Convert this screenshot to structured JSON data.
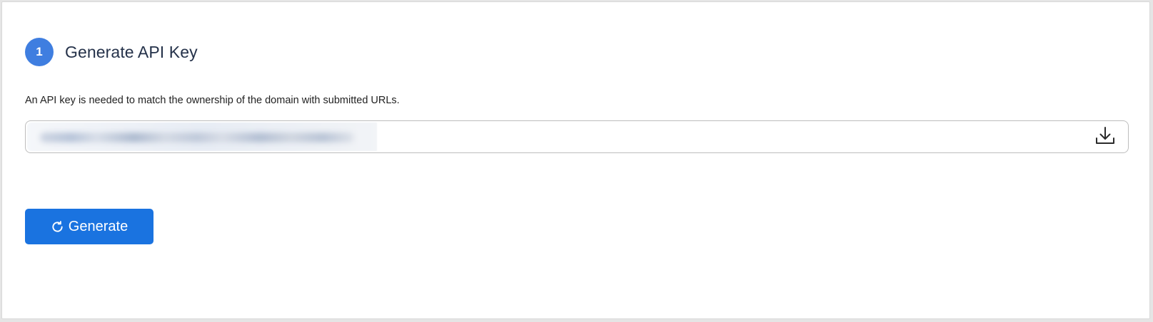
{
  "step": {
    "number": "1",
    "title": "Generate API Key"
  },
  "description": "An API key is needed to match the ownership of the domain with submitted URLs.",
  "api_key_field": {
    "value": "",
    "masked": true,
    "download_icon": "download-icon"
  },
  "actions": {
    "generate_label": "Generate",
    "generate_icon": "refresh-icon"
  },
  "colors": {
    "accent": "#1a73e0",
    "badge": "#3f7ee0",
    "title": "#25324a"
  }
}
